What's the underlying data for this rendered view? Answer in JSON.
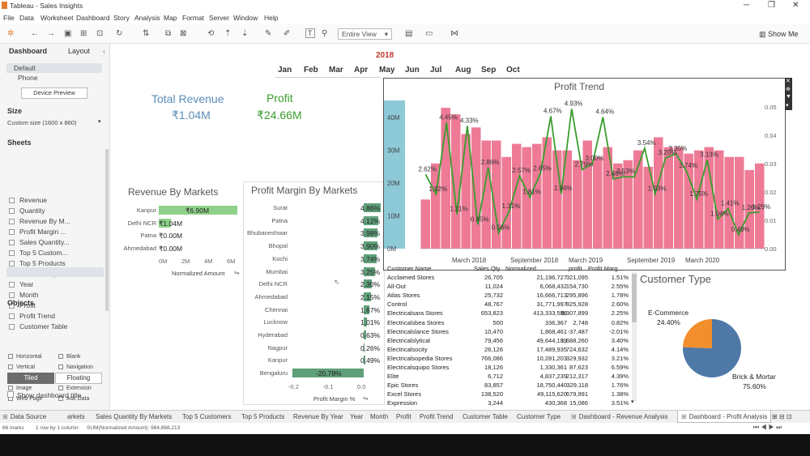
{
  "window": {
    "title": "Tableau - Sales Insights"
  },
  "menu": [
    "File",
    "Data",
    "Worksheet",
    "Dashboard",
    "Story",
    "Analysis",
    "Map",
    "Format",
    "Server",
    "Window",
    "Help"
  ],
  "toolbar": {
    "view_select": "Entire View",
    "show_me": "Show Me"
  },
  "left_panel": {
    "tab_dashboard": "Dashboard",
    "tab_layout": "Layout",
    "device_default": "Default",
    "device_phone": "Phone",
    "device_preview": "Device Preview",
    "size_heading": "Size",
    "size_value": "Custom size (1600 x 860)",
    "sheets_heading": "Sheets",
    "sheets": [
      "Revenue",
      "Quantity",
      "Revenue By M...",
      "Profit Margin ...",
      "Sales Quantity...",
      "Top 5 Custom...",
      "Top 5 Products",
      "Revenue By Y...",
      "Year",
      "Month",
      "Profit",
      "Profit Trend",
      "Customer Table"
    ],
    "objects_heading": "Objects",
    "objects": [
      "Horizontal",
      "Blank",
      "Vertical",
      "Navigation",
      "Text",
      "Download",
      "Image",
      "Extension",
      "Web Page",
      "Ask Data"
    ],
    "tiled": "Tiled",
    "floating": "Floating",
    "show_title": "Show dashboard title"
  },
  "year": "2018",
  "months": [
    "Jan",
    "Feb",
    "Mar",
    "Apr",
    "May",
    "Jun",
    "Jul",
    "Aug",
    "Sep",
    "Oct"
  ],
  "kpi": {
    "revenue_label": "Total Revenue",
    "revenue_value": "₹1.04M",
    "profit_label": "Profit",
    "profit_value": "₹24.66M"
  },
  "revenue_by_markets": {
    "title": "Revenue By Markets",
    "markets": [
      {
        "name": "Kanpur",
        "label": "₹6.90M",
        "value": 6.9
      },
      {
        "name": "Delhi NCR",
        "label": "₹1.04M",
        "value": 1.04
      },
      {
        "name": "Patna",
        "label": "₹0.00M",
        "value": 0
      },
      {
        "name": "Ahmedabad",
        "label": "₹0.00M",
        "value": 0
      }
    ],
    "ticks": [
      "0M",
      "2M",
      "4M",
      "6M"
    ],
    "max": 7,
    "axis_label": "Normalized Amount"
  },
  "profit_margin": {
    "title": "Profit Margin By Markets",
    "markets": [
      {
        "name": "Surat",
        "label": "4.86%",
        "value": 4.86
      },
      {
        "name": "Patna",
        "label": "4.12%",
        "value": 4.12
      },
      {
        "name": "Bhubaneshwar",
        "label": "3.98%",
        "value": 3.98
      },
      {
        "name": "Bhopal",
        "label": "3.90%",
        "value": 3.9
      },
      {
        "name": "Kochi",
        "label": "3.74%",
        "value": 3.74
      },
      {
        "name": "Mumbai",
        "label": "3.25%",
        "value": 3.25
      },
      {
        "name": "Delhi NCR",
        "label": "2.30%",
        "value": 2.3
      },
      {
        "name": "Ahmedabad",
        "label": "2.15%",
        "value": 2.15
      },
      {
        "name": "Chennai",
        "label": "1.67%",
        "value": 1.67
      },
      {
        "name": "Lucknow",
        "label": "1.01%",
        "value": 1.01
      },
      {
        "name": "Hyderabad",
        "label": "0.63%",
        "value": 0.63
      },
      {
        "name": "Nagpur",
        "label": "0.26%",
        "value": 0.26
      },
      {
        "name": "Kanpur",
        "label": "0.49%",
        "value": 0.49
      },
      {
        "name": "Bengaluru",
        "label": "-20.78%",
        "value": -20.78
      }
    ],
    "ticks": [
      "-0.2",
      "-0.1",
      "0.0"
    ],
    "axis_label": "Profit Margin %"
  },
  "chart_data": {
    "type": "bar",
    "title": "Profit Trend",
    "y_ticks": [
      "0M",
      "10M",
      "20M",
      "30M",
      "40M"
    ],
    "y2_ticks": [
      "0.00",
      "0.01",
      "0.02",
      "0.03",
      "0.04",
      "0.05"
    ],
    "x_ticks": [
      "March 2018",
      "September 2018",
      "March 2019",
      "September 2019",
      "March 2020"
    ],
    "bar_color": "#ee7a96",
    "line_color": "#3a9d2e",
    "revenue_millions": [
      15,
      26,
      43,
      41,
      35,
      37,
      33,
      33,
      28,
      32,
      31,
      32,
      34,
      30,
      30,
      27,
      33,
      28,
      31,
      26,
      27,
      30,
      25,
      34,
      31,
      31,
      29,
      30,
      31,
      30,
      28,
      28,
      24,
      26
    ],
    "profit_margin": [
      0.0262,
      0.0192,
      0.0445,
      0.0121,
      0.0433,
      0.0085,
      0.0286,
      0.0056,
      0.0131,
      0.0257,
      0.0181,
      0.0265,
      0.0467,
      0.0194,
      0.0493,
      0.0279,
      0.03,
      0.0464,
      0.0246,
      0.0254,
      0.0253,
      0.0354,
      0.0193,
      0.032,
      0.0335,
      0.0274,
      0.0175,
      0.0313,
      0.0104,
      0.0141,
      0.0049,
      0.0126,
      0.0129
    ],
    "labels": [
      {
        "i": 0,
        "t": "2.62%"
      },
      {
        "i": 1,
        "t": "1.92%"
      },
      {
        "i": 2,
        "t": "4.45%"
      },
      {
        "i": 3,
        "t": "1.21%"
      },
      {
        "i": 4,
        "t": "4.33%"
      },
      {
        "i": 5,
        "t": "0.85%"
      },
      {
        "i": 6,
        "t": "2.86%"
      },
      {
        "i": 7,
        "t": "0.56%"
      },
      {
        "i": 8,
        "t": "1.31%"
      },
      {
        "i": 9,
        "t": "2.57%"
      },
      {
        "i": 10,
        "t": "1.81%"
      },
      {
        "i": 11,
        "t": "2.65%"
      },
      {
        "i": 12,
        "t": "4.67%"
      },
      {
        "i": 13,
        "t": "1.94%"
      },
      {
        "i": 14,
        "t": "4.93%"
      },
      {
        "i": 15,
        "t": "2.79%"
      },
      {
        "i": 16,
        "t": "3.00%"
      },
      {
        "i": 17,
        "t": "4.64%"
      },
      {
        "i": 18,
        "t": "2.46%"
      },
      {
        "i": 19,
        "t": "2.53%"
      },
      {
        "i": 21,
        "t": "3.54%"
      },
      {
        "i": 22,
        "t": "1.93%"
      },
      {
        "i": 23,
        "t": "3.20%"
      },
      {
        "i": 24,
        "t": "3.35%"
      },
      {
        "i": 25,
        "t": "2.74%"
      },
      {
        "i": 26,
        "t": "1.75%"
      },
      {
        "i": 27,
        "t": "3.13%"
      },
      {
        "i": 28,
        "t": "1.04%"
      },
      {
        "i": 29,
        "t": "1.41%"
      },
      {
        "i": 30,
        "t": "0.49%"
      },
      {
        "i": 31,
        "t": "1.26%"
      },
      {
        "i": 32,
        "t": "1.29%"
      }
    ]
  },
  "customer_table": {
    "headers": [
      "Customer Name",
      "Sales Qty",
      "Normalized ...",
      "profit",
      "Profit Marg..."
    ],
    "rows": [
      [
        "Acclaimed Stores",
        "26,705",
        "21,196,727",
        "321,095",
        "1.51%"
      ],
      [
        "All-Out",
        "11,024",
        "6,068,432",
        "154,730",
        "2.55%"
      ],
      [
        "Atlas Stores",
        "25,732",
        "16,666,713",
        "295,896",
        "1.78%"
      ],
      [
        "Control",
        "48,767",
        "31,771,997",
        "825,928",
        "2.60%"
      ],
      [
        "Electricalsara Stores",
        "653,823",
        "413,333,588",
        "9,307,899",
        "2.25%"
      ],
      [
        "Electricalsbea Stores",
        "500",
        "336,367",
        "2,748",
        "0.82%"
      ],
      [
        "Electricalslance Stores",
        "10,470",
        "1,868,461",
        "-37,487",
        "-2.01%"
      ],
      [
        "Electricalslytical",
        "79,456",
        "49,644,189",
        "1,688,260",
        "3.40%"
      ],
      [
        "Electricalsocity",
        "26,126",
        "17,489,935",
        "724,632",
        "4.14%"
      ],
      [
        "Electricalsopedia Stores",
        "766,086",
        "10,281,203",
        "329,932",
        "3.21%"
      ],
      [
        "Electricalsquipo Stores",
        "18,126",
        "1,330,361",
        "87,623",
        "6.59%"
      ],
      [
        "Elite",
        "6,712",
        "4,837,239",
        "212,317",
        "4.39%"
      ],
      [
        "Epic Stores",
        "83,857",
        "18,750,440",
        "329,118",
        "1.76%"
      ],
      [
        "Excel Stores",
        "138,520",
        "49,115,620",
        "679,991",
        "1.38%"
      ],
      [
        "Expression",
        "3,244",
        "430,368",
        "15,086",
        "3.51%"
      ]
    ]
  },
  "customer_type": {
    "title": "Customer Type",
    "segments": [
      {
        "name": "E-Commerce",
        "pct": "24.40%",
        "value": 24.4,
        "color": "#f28e2b"
      },
      {
        "name": "Brick & Mortar",
        "pct": "75.60%",
        "value": 75.6,
        "color": "#4e79a7"
      }
    ]
  },
  "bottom_tabs": [
    "Data Source",
    "arkets",
    "Sales Quantity By Markets",
    "Top 5 Customers",
    "Top 5 Products",
    "Revenue By Year",
    "Year",
    "Month",
    "Profit",
    "Profit Trend",
    "Customer Table",
    "Customer Type",
    "Dashboard - Revenue Analysis",
    "Dashboard - Profit Analysis"
  ],
  "status": {
    "marks": "66 marks",
    "rows": "1 row by 1 column",
    "sum": "SUM(Normalized Amount): 984,868,213"
  }
}
